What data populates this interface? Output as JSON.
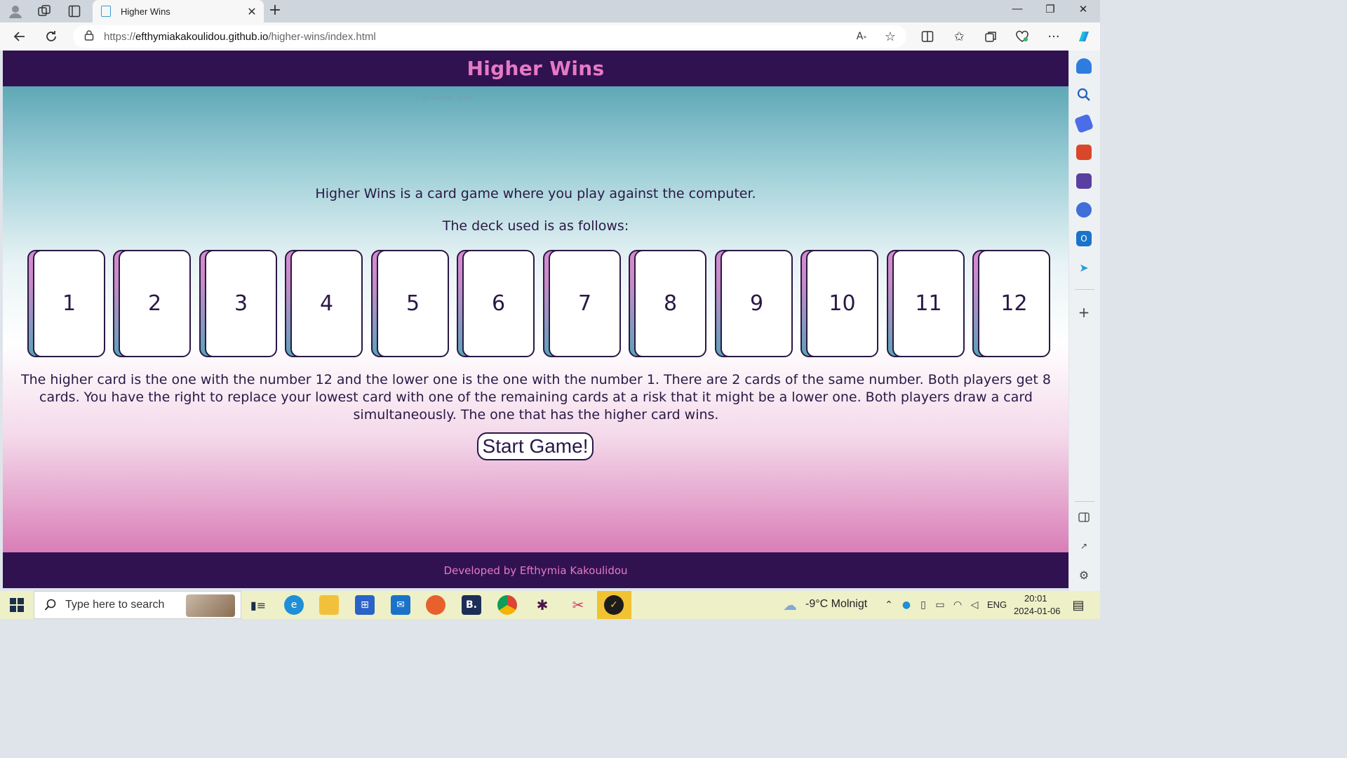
{
  "browser": {
    "tab_title": "Higher Wins",
    "url_prefix": "https://",
    "url_host": "efthymiakakoulidou.github.io",
    "url_path": "/higher-wins/index.html"
  },
  "page": {
    "title": "Higher Wins",
    "snip_overlay": "Full-screen Snip",
    "intro_line1": "Higher Wins is a card game where you play against the computer.",
    "intro_line2": "The deck used is as follows:",
    "cards": [
      "1",
      "2",
      "3",
      "4",
      "5",
      "6",
      "7",
      "8",
      "9",
      "10",
      "11",
      "12"
    ],
    "rules": "The higher card is the one with the number 12 and the lower one is the one with the number 1. There are 2 cards of the same number. Both players get 8 cards. You have the right to replace your lowest card with one of the remaining cards at a risk that it might be a lower one. Both players draw a card simultaneously. The one that has the higher card wins.",
    "start_button": "Start Game!",
    "footer": "Developed by Efthymia Kakoulidou"
  },
  "taskbar": {
    "search_placeholder": "Type here to search",
    "weather": "-9°C  Molnigt",
    "language": "ENG",
    "time": "20:01",
    "date": "2024-01-06"
  },
  "colors": {
    "header_bg": "#301250",
    "title_pink": "#e679c5",
    "text_dark": "#2a1846"
  }
}
